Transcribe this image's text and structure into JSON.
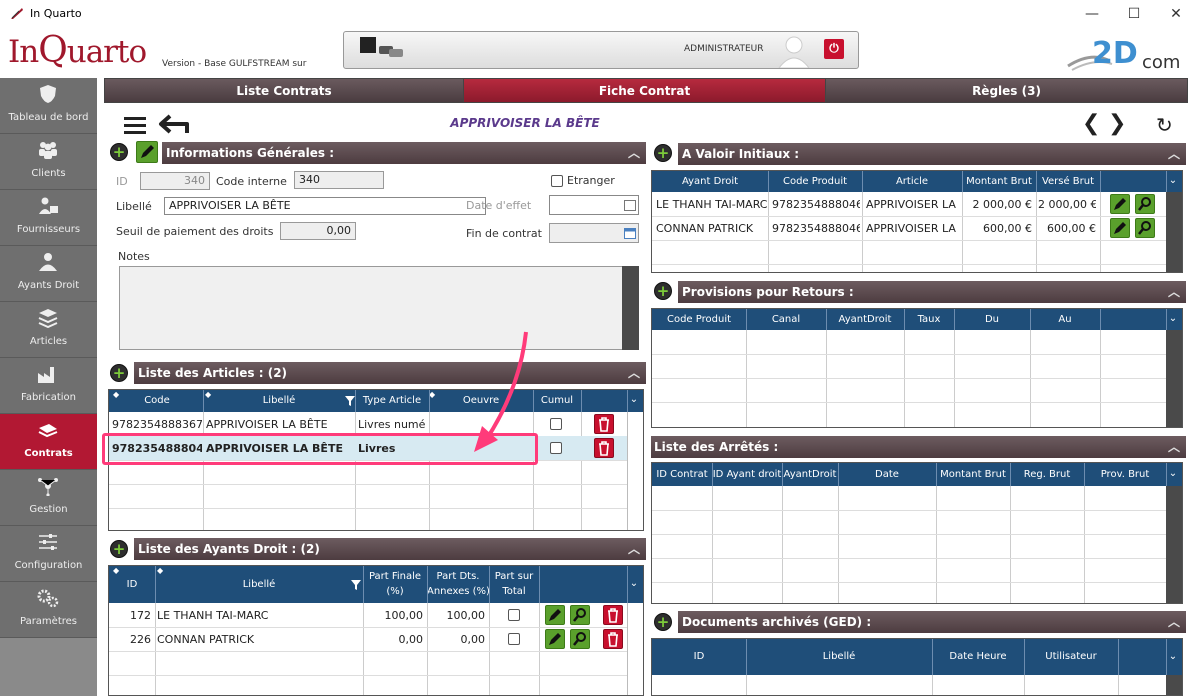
{
  "window": {
    "title": "In Quarto",
    "minimize": "—",
    "maximize": "☐",
    "close": "✕"
  },
  "header": {
    "logo_in": "In",
    "logo_q": "Q",
    "logo_rest": "uarto",
    "version": "Version  - Base GULFSTREAM sur",
    "user": "ADMINISTRATEUR",
    "power": "⏻",
    "brand_2d": "2D",
    "brand_com": "com"
  },
  "sidebar": {
    "items": [
      {
        "label": "Tableau de bord",
        "icon": "shield-icon"
      },
      {
        "label": "Clients",
        "icon": "users-icon"
      },
      {
        "label": "Fournisseurs",
        "icon": "supplier-icon"
      },
      {
        "label": "Ayants Droit",
        "icon": "person-icon"
      },
      {
        "label": "Articles",
        "icon": "stack-icon"
      },
      {
        "label": "Fabrication",
        "icon": "factory-icon"
      },
      {
        "label": "Contrats",
        "icon": "contract-icon"
      },
      {
        "label": "Gestion",
        "icon": "network-icon"
      },
      {
        "label": "Configuration",
        "icon": "sliders-icon"
      },
      {
        "label": "Paramètres",
        "icon": "gears-icon"
      }
    ],
    "active": "Contrats"
  },
  "tabs": [
    {
      "label": "Liste Contrats"
    },
    {
      "label": "Fiche Contrat"
    },
    {
      "label": "Règles (3)"
    }
  ],
  "toolbar": {
    "title": "APPRIVOISER LA BÊTE",
    "prev": "❮",
    "next": "❯",
    "refresh": "↻"
  },
  "info": {
    "header": "Informations Générales :",
    "id_label": "ID",
    "id_value": "340",
    "code_label": "Code interne",
    "code_value": "340",
    "etranger_label": "Etranger",
    "libelle_label": "Libellé",
    "libelle_value": "APPRIVOISER LA BÊTE",
    "date_effet_label": "Date d'effet",
    "seuil_label": "Seuil de paiement des droits",
    "seuil_value": "0,00",
    "fin_label": "Fin de contrat",
    "notes_label": "Notes"
  },
  "articles": {
    "header": "Liste des Articles : (2)",
    "columns": [
      "Code",
      "Libellé",
      "Type Article",
      "Oeuvre",
      "Cumul"
    ],
    "rows": [
      {
        "code": "9782354888367",
        "libelle": "APPRIVOISER LA BÊTE",
        "type": "Livres numé",
        "oeuvre": ""
      },
      {
        "code": "9782354888046",
        "libelle": "APPRIVOISER LA BÊTE",
        "type": "Livres",
        "oeuvre": ""
      }
    ]
  },
  "ayants": {
    "header": "Liste des Ayants Droit : (2)",
    "columns": [
      "ID",
      "Libellé",
      "Part Finale (%)",
      "Part Dts. Annexes (%)",
      "Part sur Total"
    ],
    "col_part_finale": [
      "Part Finale",
      "(%)"
    ],
    "col_part_dts": [
      "Part Dts.",
      "Annexes (%)"
    ],
    "col_part_total": [
      "Part sur",
      "Total"
    ],
    "rows": [
      {
        "id": "172",
        "libelle": "LE THANH TAI-MARC",
        "finale": "100,00",
        "annexes": "100,00"
      },
      {
        "id": "226",
        "libelle": "CONNAN PATRICK",
        "finale": "0,00",
        "annexes": "0,00"
      }
    ]
  },
  "valoir": {
    "header": "A Valoir Initiaux :",
    "columns": [
      "Ayant Droit",
      "Code Produit",
      "Article",
      "Montant Brut",
      "Versé Brut"
    ],
    "rows": [
      {
        "ayant": "LE THANH TAI-MARC",
        "code": "9782354888046",
        "article": "APPRIVOISER LA E",
        "montant": "2 000,00 €",
        "verse": "2 000,00 €"
      },
      {
        "ayant": "CONNAN PATRICK",
        "code": "9782354888046",
        "article": "APPRIVOISER LA E",
        "montant": "600,00 €",
        "verse": "600,00 €"
      }
    ]
  },
  "provisions": {
    "header": "Provisions pour Retours :",
    "columns": [
      "Code Produit",
      "Canal",
      "AyantDroit",
      "Taux",
      "Du",
      "Au"
    ]
  },
  "arretes": {
    "header": "Liste des Arrêtés :",
    "columns": [
      "ID Contrat",
      "ID Ayant droit",
      "AyantDroit",
      "Date",
      "Montant Brut",
      "Reg. Brut",
      "Prov. Brut"
    ]
  },
  "documents": {
    "header": "Documents archivés (GED) :",
    "columns": [
      "ID",
      "Libellé",
      "Date Heure",
      "Utilisateur"
    ]
  },
  "colors": {
    "brand": "#b21833",
    "table_header": "#1f4e79",
    "section_header": "#5c4a4e",
    "highlight": "#ff3b7a"
  }
}
